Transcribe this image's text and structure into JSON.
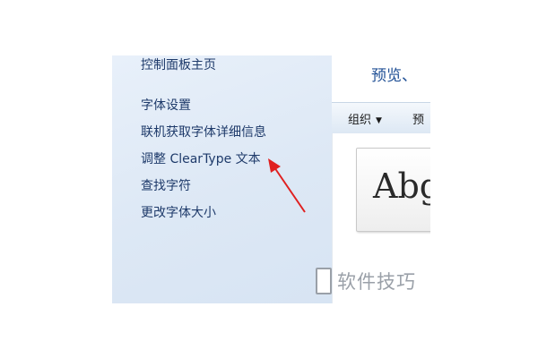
{
  "sidebar": {
    "home_link": "控制面板主页",
    "links": [
      "字体设置",
      "联机获取字体详细信息",
      "调整 ClearType 文本",
      "查找字符",
      "更改字体大小"
    ]
  },
  "main": {
    "title": "预览、",
    "toolbar": {
      "organize_label": "组织",
      "preview_label": "预"
    },
    "font_tile": {
      "sample_text": "Abg"
    }
  },
  "annotation": {
    "arrow_color": "#e02020"
  },
  "watermark": {
    "text": "软件技巧"
  }
}
